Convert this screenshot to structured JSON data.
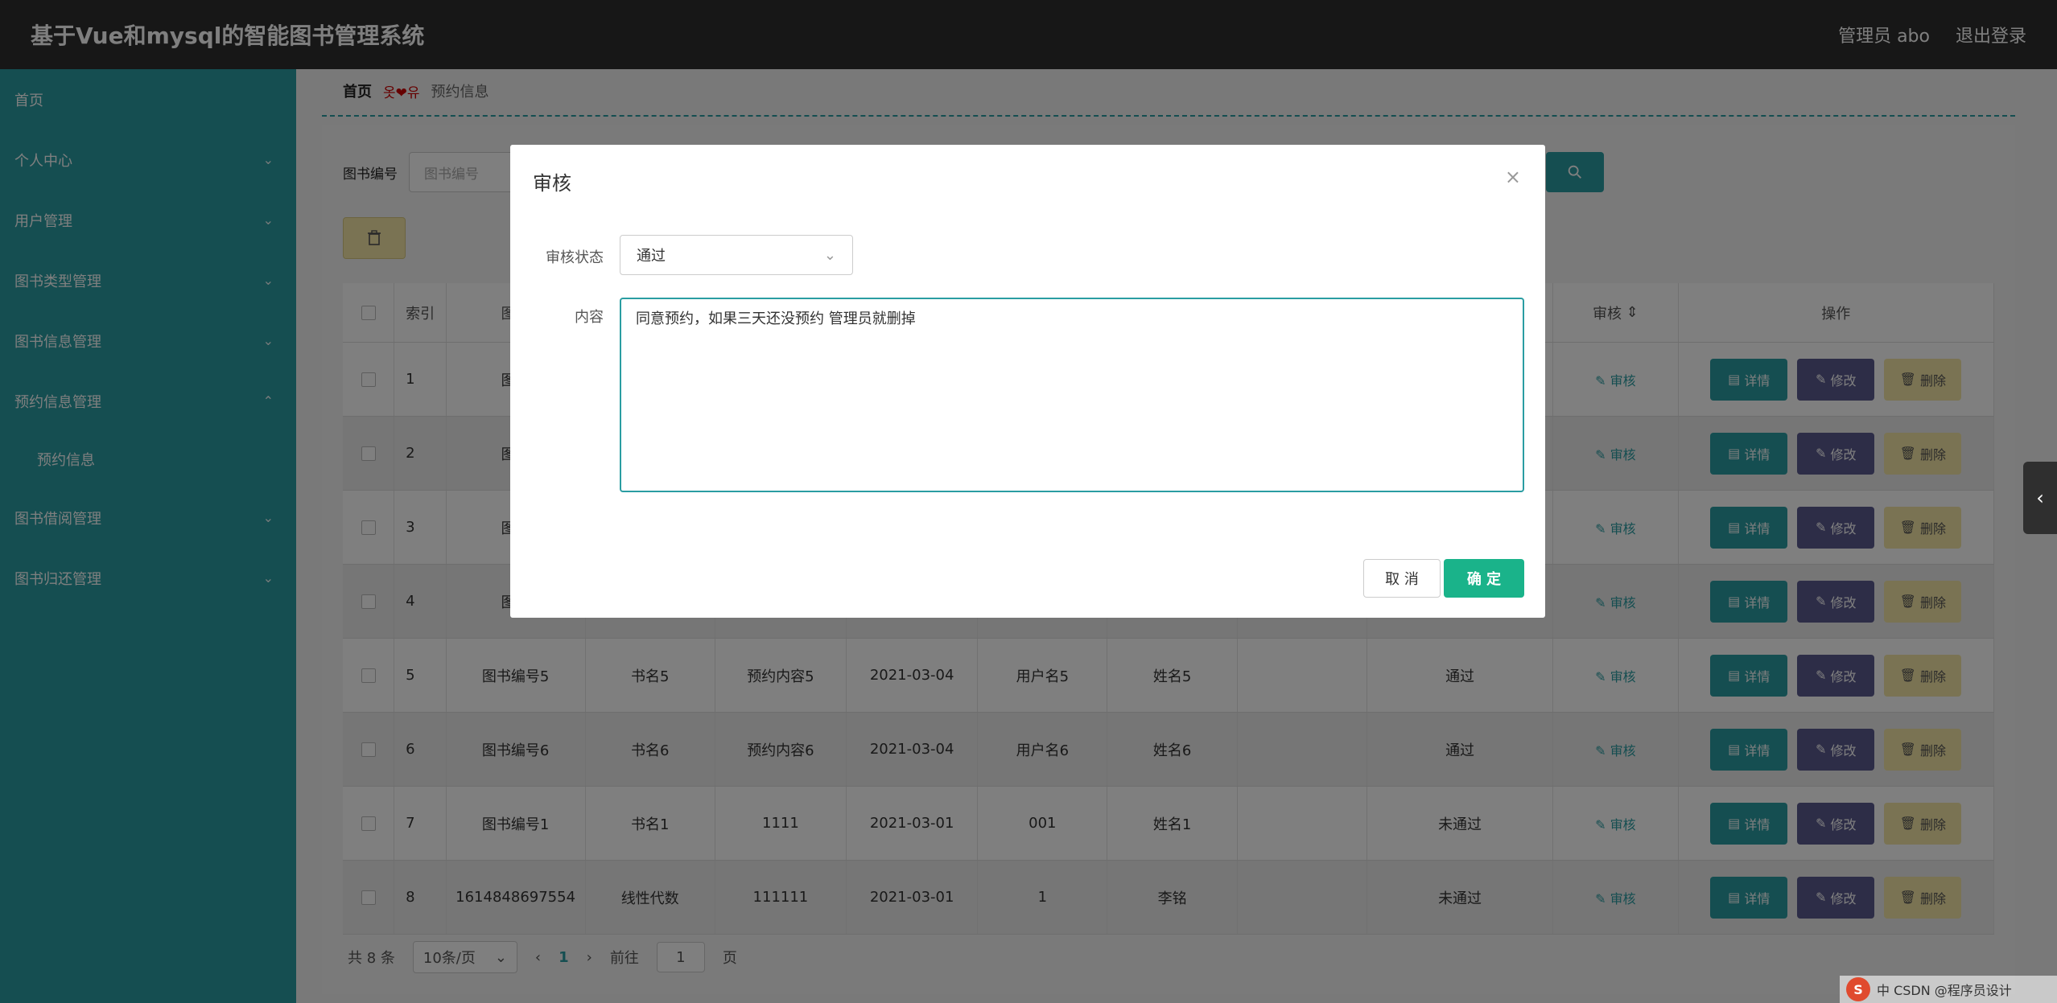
{
  "header": {
    "title": "基于Vue和mysql的智能图书管理系统",
    "user": "管理员 abo",
    "logout": "退出登录"
  },
  "sidebar": {
    "items": [
      {
        "label": "首页",
        "chevron": ""
      },
      {
        "label": "个人中心",
        "chevron": "⌄"
      },
      {
        "label": "用户管理",
        "chevron": "⌄"
      },
      {
        "label": "图书类型管理",
        "chevron": "⌄"
      },
      {
        "label": "图书信息管理",
        "chevron": "⌄"
      },
      {
        "label": "预约信息管理",
        "chevron": "⌃"
      }
    ],
    "sub_item": "预约信息",
    "items_after": [
      {
        "label": "图书借阅管理",
        "chevron": "⌄"
      },
      {
        "label": "图书归还管理",
        "chevron": "⌄"
      }
    ]
  },
  "breadcrumb": {
    "home": "首页",
    "deco": "옷❤유",
    "current": "预约信息"
  },
  "search": {
    "label": "图书编号",
    "placeholder": "图书编号"
  },
  "table": {
    "headers": [
      "",
      "索引",
      "图书",
      "",
      "",
      "",
      "",
      "",
      "",
      "",
      "审核",
      "操作"
    ],
    "audit_label": "审核",
    "detail_label": "详情",
    "edit_label": "修改",
    "delete_label": "删除",
    "rows": [
      {
        "idx": "1",
        "code": "图书",
        "name": "",
        "content": "",
        "date": "",
        "user": "",
        "realname": "",
        "blank": "",
        "status": ""
      },
      {
        "idx": "2",
        "code": "图书",
        "name": "",
        "content": "",
        "date": "",
        "user": "",
        "realname": "",
        "blank": "",
        "status": ""
      },
      {
        "idx": "3",
        "code": "图书",
        "name": "",
        "content": "",
        "date": "",
        "user": "",
        "realname": "",
        "blank": "",
        "status": ""
      },
      {
        "idx": "4",
        "code": "图书",
        "name": "",
        "content": "",
        "date": "",
        "user": "",
        "realname": "",
        "blank": "",
        "status": ""
      },
      {
        "idx": "5",
        "code": "图书编号5",
        "name": "书名5",
        "content": "预约内容5",
        "date": "2021-03-04",
        "user": "用户名5",
        "realname": "姓名5",
        "blank": "",
        "status": "通过"
      },
      {
        "idx": "6",
        "code": "图书编号6",
        "name": "书名6",
        "content": "预约内容6",
        "date": "2021-03-04",
        "user": "用户名6",
        "realname": "姓名6",
        "blank": "",
        "status": "通过"
      },
      {
        "idx": "7",
        "code": "图书编号1",
        "name": "书名1",
        "content": "1111",
        "date": "2021-03-01",
        "user": "001",
        "realname": "姓名1",
        "blank": "",
        "status": "未通过"
      },
      {
        "idx": "8",
        "code": "1614848697554",
        "name": "线性代数",
        "content": "111111",
        "date": "2021-03-01",
        "user": "1",
        "realname": "李铭",
        "blank": "",
        "status": "未通过"
      }
    ]
  },
  "pagination": {
    "total": "共 8 条",
    "page_size": "10条/页",
    "current": "1",
    "goto": "前往",
    "goto_value": "1",
    "page_unit": "页"
  },
  "dialog": {
    "title": "审核",
    "status_label": "审核状态",
    "status_value": "通过",
    "content_label": "内容",
    "content_value": "同意预约，如果三天还没预约 管理员就删掉",
    "cancel": "取 消",
    "confirm": "确 定"
  },
  "footer": {
    "text": "中 CSDN @程序员设计"
  }
}
